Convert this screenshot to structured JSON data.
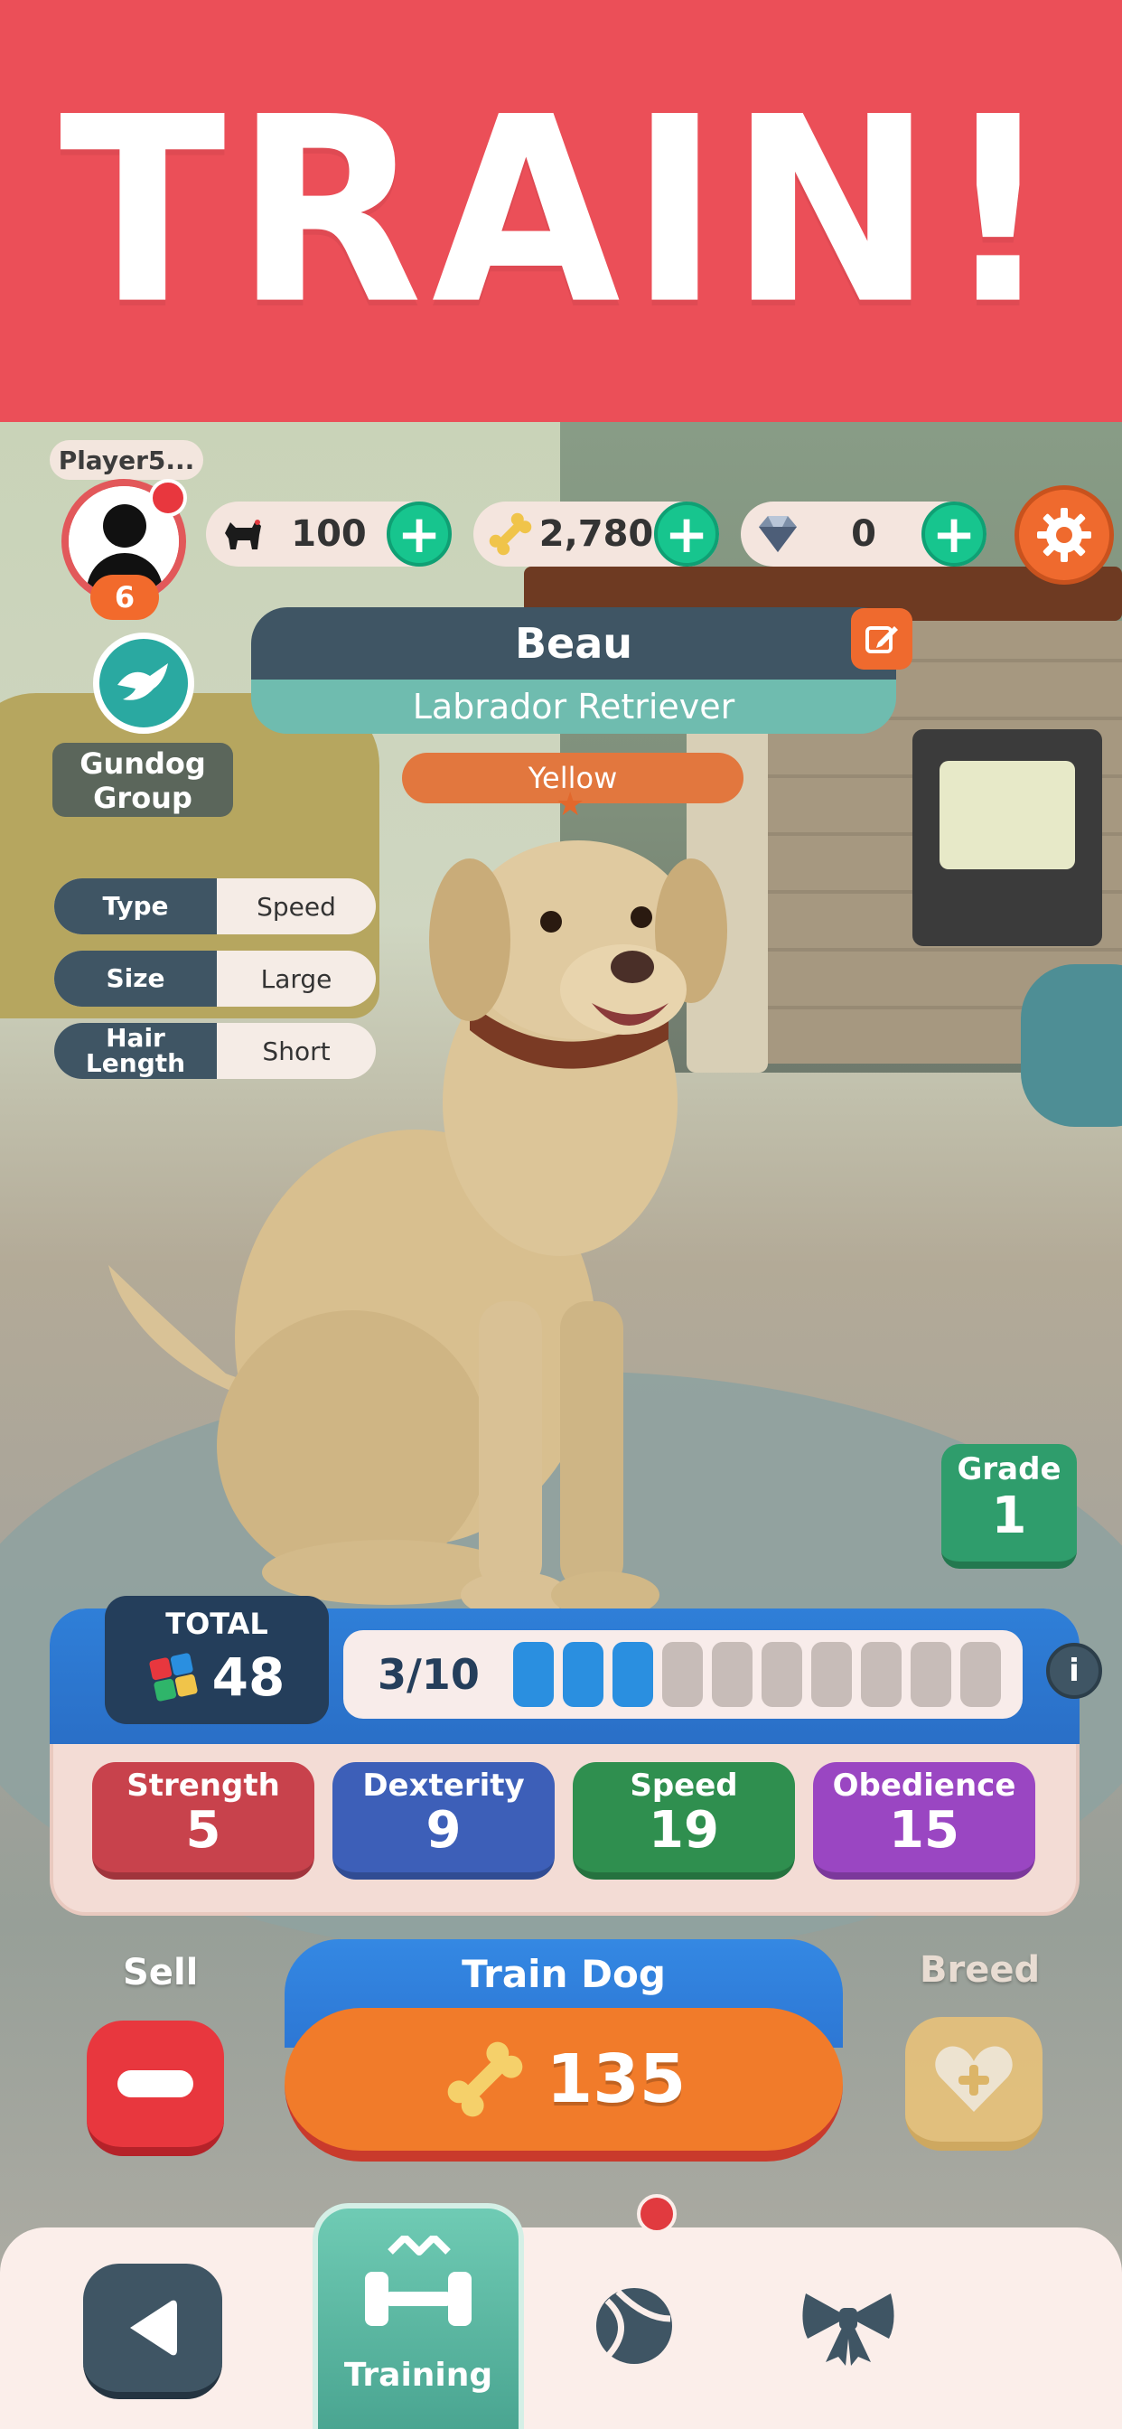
{
  "banner": {
    "title": "TRAIN!"
  },
  "player": {
    "name": "Player5...",
    "level": "6"
  },
  "resources": [
    {
      "icon": "dog-silhouette-icon",
      "value": "100"
    },
    {
      "icon": "bone-icon",
      "value": "2,780"
    },
    {
      "icon": "diamond-icon",
      "value": "0"
    }
  ],
  "group": {
    "label_line1": "Gundog",
    "label_line2": "Group"
  },
  "dog": {
    "name": "Beau",
    "breed": "Labrador Retriever",
    "color": "Yellow"
  },
  "traits": [
    {
      "key": "Type",
      "value": "Speed"
    },
    {
      "key": "Size",
      "value": "Large"
    },
    {
      "key_line1": "Hair",
      "key_line2": "Length",
      "value": "Short"
    }
  ],
  "grade": {
    "label": "Grade",
    "value": "1"
  },
  "stats": {
    "total_label": "TOTAL",
    "total_value": "48",
    "progress_text": "3/10",
    "progress_filled": 3,
    "progress_max": 10,
    "items": [
      {
        "name": "Strength",
        "value": "5",
        "color": "#c8424c"
      },
      {
        "name": "Dexterity",
        "value": "9",
        "color": "#3d5fb8"
      },
      {
        "name": "Speed",
        "value": "19",
        "color": "#2f8f4f"
      },
      {
        "name": "Obedience",
        "value": "15",
        "color": "#9a46c2"
      }
    ]
  },
  "actions": {
    "sell_label": "Sell",
    "train_label": "Train Dog",
    "train_cost": "135",
    "breed_label": "Breed"
  },
  "tabbar": {
    "active_label": "Training"
  },
  "colors": {
    "banner": "#eb4f58",
    "accent_green": "#17c58e",
    "accent_orange": "#ef6a2e",
    "navy": "#3f5564"
  }
}
